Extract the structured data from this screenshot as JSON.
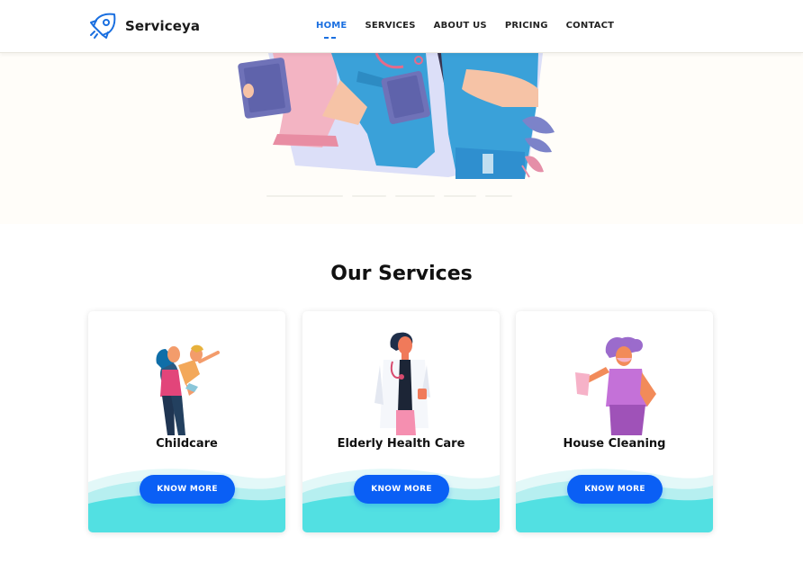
{
  "navbar": {
    "brand_name": "Serviceya",
    "items": [
      {
        "label": "HOME",
        "active": true
      },
      {
        "label": "SERVICES",
        "active": false
      },
      {
        "label": "ABOUT US",
        "active": false
      },
      {
        "label": "PRICING",
        "active": false
      },
      {
        "label": "CONTACT",
        "active": false
      }
    ]
  },
  "hero": {
    "illustration": "healthcare-workers-illustration",
    "slides_count": 5
  },
  "services": {
    "title": "Our Services",
    "cards": [
      {
        "title": "Childcare",
        "button": "KNOW MORE",
        "illustration": "mother-with-child-illustration"
      },
      {
        "title": "Elderly Health Care",
        "button": "KNOW MORE",
        "illustration": "doctor-illustration"
      },
      {
        "title": "House Cleaning",
        "button": "KNOW MORE",
        "illustration": "cleaner-illustration"
      }
    ]
  },
  "colors": {
    "accent": "#1a6fe0",
    "button": "#0a5ff5",
    "wave": "#52e0e2",
    "wave_light": "#d9f7f7"
  },
  "icons": [
    "rocket-logo-icon"
  ]
}
